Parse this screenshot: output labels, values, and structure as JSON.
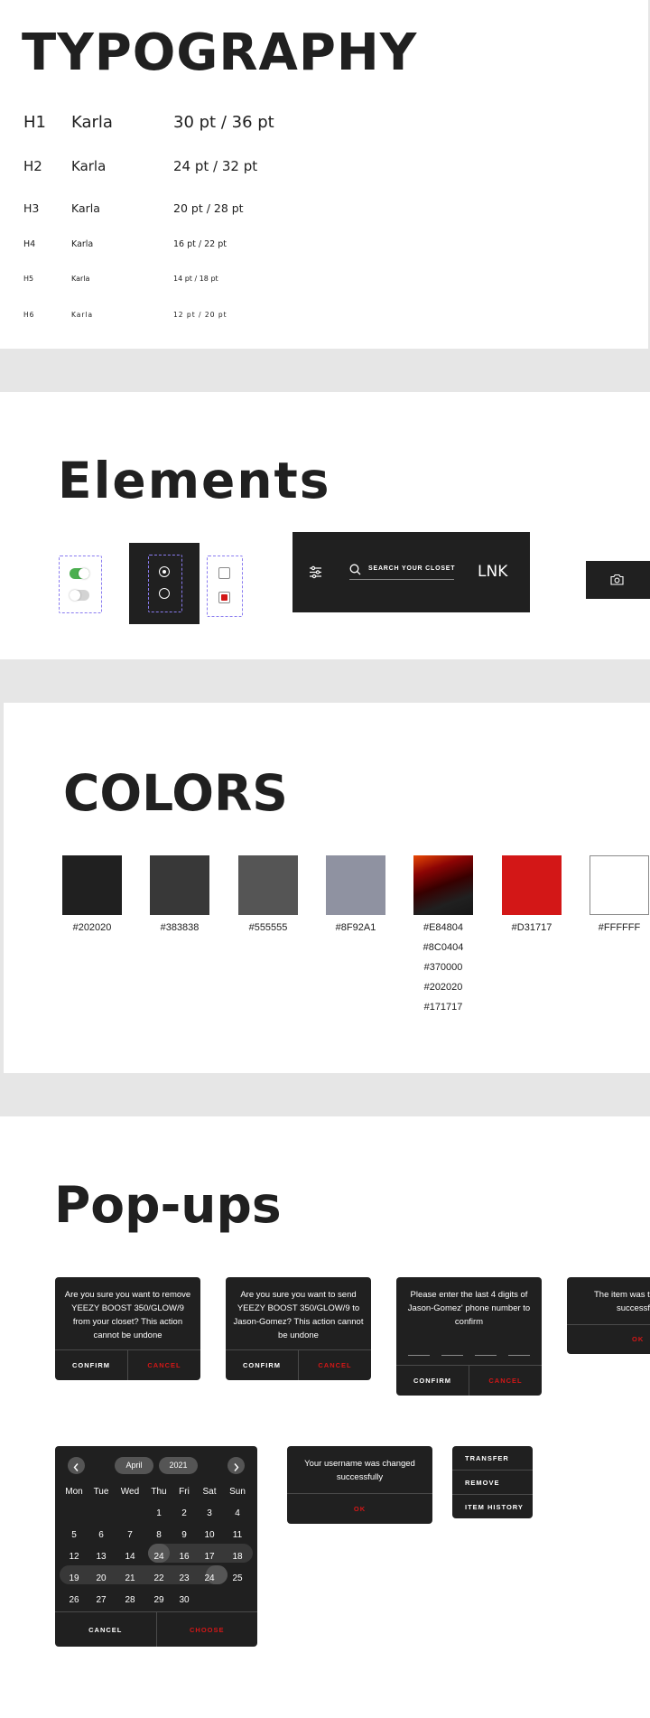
{
  "typography": {
    "title": "TYPOGRAPHY",
    "rows": [
      {
        "tag": "H1",
        "font": "Karla",
        "size": "30 pt / 36 pt"
      },
      {
        "tag": "H2",
        "font": "Karla",
        "size": "24 pt / 32 pt"
      },
      {
        "tag": "H3",
        "font": "Karla",
        "size": "20 pt / 28 pt"
      },
      {
        "tag": "H4",
        "font": "Karla",
        "size": "16 pt / 22 pt"
      },
      {
        "tag": "H5",
        "font": "Karla",
        "size": "14 pt / 18 pt"
      },
      {
        "tag": "H6",
        "font": "Karla",
        "size": "12 pt / 20 pt"
      }
    ]
  },
  "elements": {
    "title": "Elements",
    "search_placeholder": "SEARCH YOUR CLOSET",
    "logo": "LNK",
    "toggle_on_color": "#4caf50",
    "checkbox_checked_color": "#D31717"
  },
  "colors": {
    "title": "COLORS",
    "swatches": [
      {
        "hex": "#202020",
        "label": "#202020"
      },
      {
        "hex": "#383838",
        "label": "#383838"
      },
      {
        "hex": "#555555",
        "label": "#555555"
      },
      {
        "hex": "#8F92A1",
        "label": "#8F92A1"
      },
      {
        "hex": "gradient",
        "labels": [
          "#E84804",
          "#8C0404",
          "#370000",
          "#202020",
          "#171717"
        ]
      },
      {
        "hex": "#D31717",
        "label": "#D31717"
      },
      {
        "hex": "#FFFFFF",
        "label": "#FFFFFF"
      }
    ]
  },
  "popups": {
    "title": "Pop-ups",
    "remove": {
      "message": "Are you sure you want to remove YEEZY BOOST 350/GLOW/9 from your closet? This action cannot be undone",
      "confirm": "CONFIRM",
      "cancel": "CANCEL"
    },
    "send": {
      "message": "Are you sure you want to send YEEZY BOOST 350/GLOW/9 to Jason-Gomez? This action cannot be undone",
      "confirm": "CONFIRM",
      "cancel": "CANCEL"
    },
    "phone": {
      "message": "Please enter the last 4 digits of Jason-Gomez' phone number to confirm",
      "confirm": "CONFIRM",
      "cancel": "CANCEL"
    },
    "item": {
      "message_line1": "The item was t",
      "message_line2": "successf",
      "ok": "OK"
    },
    "username": {
      "message": "Your username was changed successfully",
      "ok": "OK"
    },
    "menu": [
      "TRANSFER",
      "REMOVE",
      "ITEM HISTORY"
    ],
    "calendar": {
      "month": "April",
      "year": "2021",
      "weekdays": [
        "Mon",
        "Tue",
        "Wed",
        "Thu",
        "Fri",
        "Sat",
        "Sun"
      ],
      "weeks": [
        [
          "",
          "",
          "",
          "1",
          "2",
          "3",
          "4"
        ],
        [
          "5",
          "6",
          "7",
          "8",
          "9",
          "10",
          "11"
        ],
        [
          "12",
          "13",
          "14",
          "24",
          "16",
          "17",
          "18"
        ],
        [
          "19",
          "20",
          "21",
          "22",
          "23",
          "24",
          "25"
        ],
        [
          "26",
          "27",
          "28",
          "29",
          "30",
          "",
          ""
        ]
      ],
      "cancel": "CANCEL",
      "choose": "CHOOSE"
    }
  }
}
